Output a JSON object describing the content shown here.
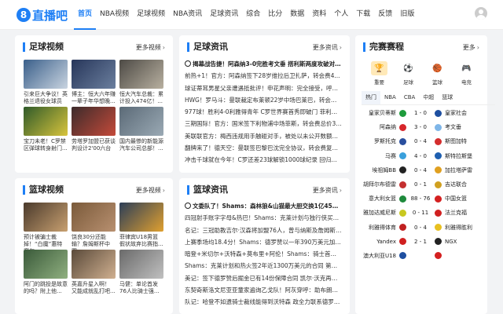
{
  "site": {
    "logo_glyph": "8",
    "logo_text": "直播吧"
  },
  "nav": [
    "首页",
    "NBA视频",
    "足球视频",
    "NBA资讯",
    "足球资讯",
    "综合",
    "比分",
    "数据",
    "资料",
    "个人",
    "下载",
    "反馈",
    "旧版"
  ],
  "football_video": {
    "title": "足球视频",
    "more": "更多视频",
    "items": [
      {
        "caption": "引来巨大争议！英格兰退役女球员",
        "colors": [
          "#3a5f8a",
          "#c9d4e0"
        ]
      },
      {
        "caption": "博主：恒大六年赚一辈子年华想晚...",
        "colors": [
          "#27365a",
          "#6b7f9e"
        ]
      },
      {
        "caption": "恒大汽车总裁：累计投入474亿！...",
        "colors": [
          "#4d4a45",
          "#b8b0a0"
        ]
      },
      {
        "caption": "宝刀未老！C罗禁区弹球转身射门...",
        "colors": [
          "#2f5a2a",
          "#d8c43c"
        ]
      },
      {
        "caption": "劳塔罗加盟已获谈判设计2'00六台",
        "colors": [
          "#3c2b2b",
          "#c44a3a"
        ]
      },
      {
        "caption": "国内最惨的新能源汽车公司总部！...",
        "colors": [
          "#5b6a77",
          "#9aa9b4"
        ]
      }
    ]
  },
  "football_news": {
    "title": "足球资讯",
    "more": "更多资讯",
    "items": [
      "揭幕战告捷！阿森纳3-0完胜考文垂 搭利斯两度攻破对手...",
      "前热+1！官方：阿森纳签下28岁维拉后卫扎萨，转会费4...",
      "球证蒂耳男星父亲遭遇抵批评！申花声明：完全接受，呼吁理...",
      "HWG！罗马斗：曼联裁定布莱顿22岁中场巴莱巴，转会总价7...",
      "977球！胜利4-0利雅得青年 C罗世界赛首秀即破门 菲利克斯...",
      "三期国际！官方：国米签下利物浦中场菲斯，转会费总价350...",
      "美联联官方：梅西违规用手触碰对手，被处以未公开数额的罚款",
      "翻牌来了！德天空：曼联签巴黎巴沈完全协议，转会费复少700...",
      "冲击千球就在今年！C罗还差23球解锁1000球纪录 回归首战..."
    ]
  },
  "basketball_video": {
    "title": "篮球视频",
    "more": "更多视频",
    "items": [
      {
        "caption": "预计被骗士裁掉！“白魔”惠特摩尔...",
        "colors": [
          "#4a3a2c",
          "#c8a070"
        ]
      },
      {
        "caption": "饶良30分还能输？詹姆斯杯中国...",
        "colors": [
          "#7a5a3a",
          "#b89070"
        ]
      },
      {
        "caption": "菲律宾U18男篮假状故弃比赛指...",
        "colors": [
          "#2c3e58",
          "#e0a030"
        ]
      },
      {
        "caption": "阿门的跳投是故意的吗？附上他...",
        "colors": [
          "#3a5a3a",
          "#90b080"
        ]
      },
      {
        "caption": "英嘉升星入啊！ 又能成就乱打吧...",
        "colors": [
          "#5a4a3a",
          "#d0b090"
        ]
      },
      {
        "caption": "马健：单论首发76人比骑士强...",
        "colors": [
          "#6a6a6a",
          "#c0c0c0"
        ]
      }
    ]
  },
  "basketball_news": {
    "title": "篮球资讯",
    "more": "更多资讯",
    "items": [
      "文委队了！Shams：森林狼&山猫最大胆交换1亿45亿美元...",
      "四冠射手账字字母&热巴！Shams：克莱计划与独行侠买断后...",
      "名记：三冠助教吉尔·汉森将加盟76人，曾与纳斯及詹姆斯打合...",
      "上赛季场均18.4分！Shams：德罗赞以一年390万美元加盟...",
      "暗登+米切尔+沃特森+莫布里+阿伦！Shams：骑士首发身...",
      "Shams：克莱计划和热火签2年近1300万美元的合同 第二年...",
      "美记：签下德罗赞后掘金已有14份保障合同 凯尔·沃克再留队...",
      "东契奇斯洛文尼亚亚童家遍询乙戈队！阿灰穿呼：助布朗出来了！",
      "队记：哈登不如遗骑士裁线能得到沃特森 政全力联系德罗赞等..."
    ]
  },
  "schedule": {
    "title": "完赛赛程",
    "more": "更多",
    "categories": [
      {
        "label": "重要",
        "icon": "trophy-icon",
        "glyph": "🏆"
      },
      {
        "label": "足球",
        "icon": "football-field-icon",
        "glyph": "⚽"
      },
      {
        "label": "篮球",
        "icon": "basketball-court-icon",
        "glyph": "🏀"
      },
      {
        "label": "电竞",
        "icon": "gamepad-icon",
        "glyph": "🎮"
      }
    ],
    "tabs": [
      "热门",
      "NBA",
      "CBA",
      "中超",
      "篮球"
    ],
    "matches": [
      {
        "home": "皇家贝蒂斯",
        "score": "1 - 0",
        "away": "皇家社会",
        "hc": "#1e9b3c",
        "ac": "#1e4fa0"
      },
      {
        "home": "阿森纳",
        "score": "3 - 0",
        "away": "考文垂",
        "hc": "#d7262b",
        "ac": "#7fb6e8"
      },
      {
        "home": "罗斯托克",
        "score": "0 - 4",
        "away": "斯图加特",
        "hc": "#2a4f9e",
        "ac": "#d42d2d"
      },
      {
        "home": "马赛",
        "score": "4 - 0",
        "away": "斯特拉斯堡",
        "hc": "#3aa0dc",
        "ac": "#1e5fb0"
      },
      {
        "home": "埃祖姆BB",
        "score": "0 - 4",
        "away": "加拉塔萨雷",
        "hc": "#222222",
        "ac": "#e0a020"
      },
      {
        "home": "胡拜尔布德雷",
        "score": "0 - 1",
        "away": "吉达联合",
        "hc": "#c43030",
        "ac": "#d0a020"
      },
      {
        "home": "意大利女篮",
        "score": "88 - 76",
        "away": "中国女篮",
        "hc": "#1e8a3c",
        "ac": "#d42020"
      },
      {
        "home": "雅加达威尼斯",
        "score": "0 - 11",
        "away": "法兰克福",
        "hc": "#c8c820",
        "ac": "#d02020"
      },
      {
        "home": "利雅得体育",
        "score": "0 - 4",
        "away": "利雅得胜利",
        "hc": "#c02020",
        "ac": "#e8c020"
      },
      {
        "home": "Yandex",
        "score": "2 - 1",
        "away": "NGX",
        "hc": "#d02020",
        "ac": "#222222"
      },
      {
        "home": "澳大利亚U18",
        "score": "",
        "away": "",
        "hc": "#1e4fa0",
        "ac": "#d42020"
      }
    ]
  }
}
